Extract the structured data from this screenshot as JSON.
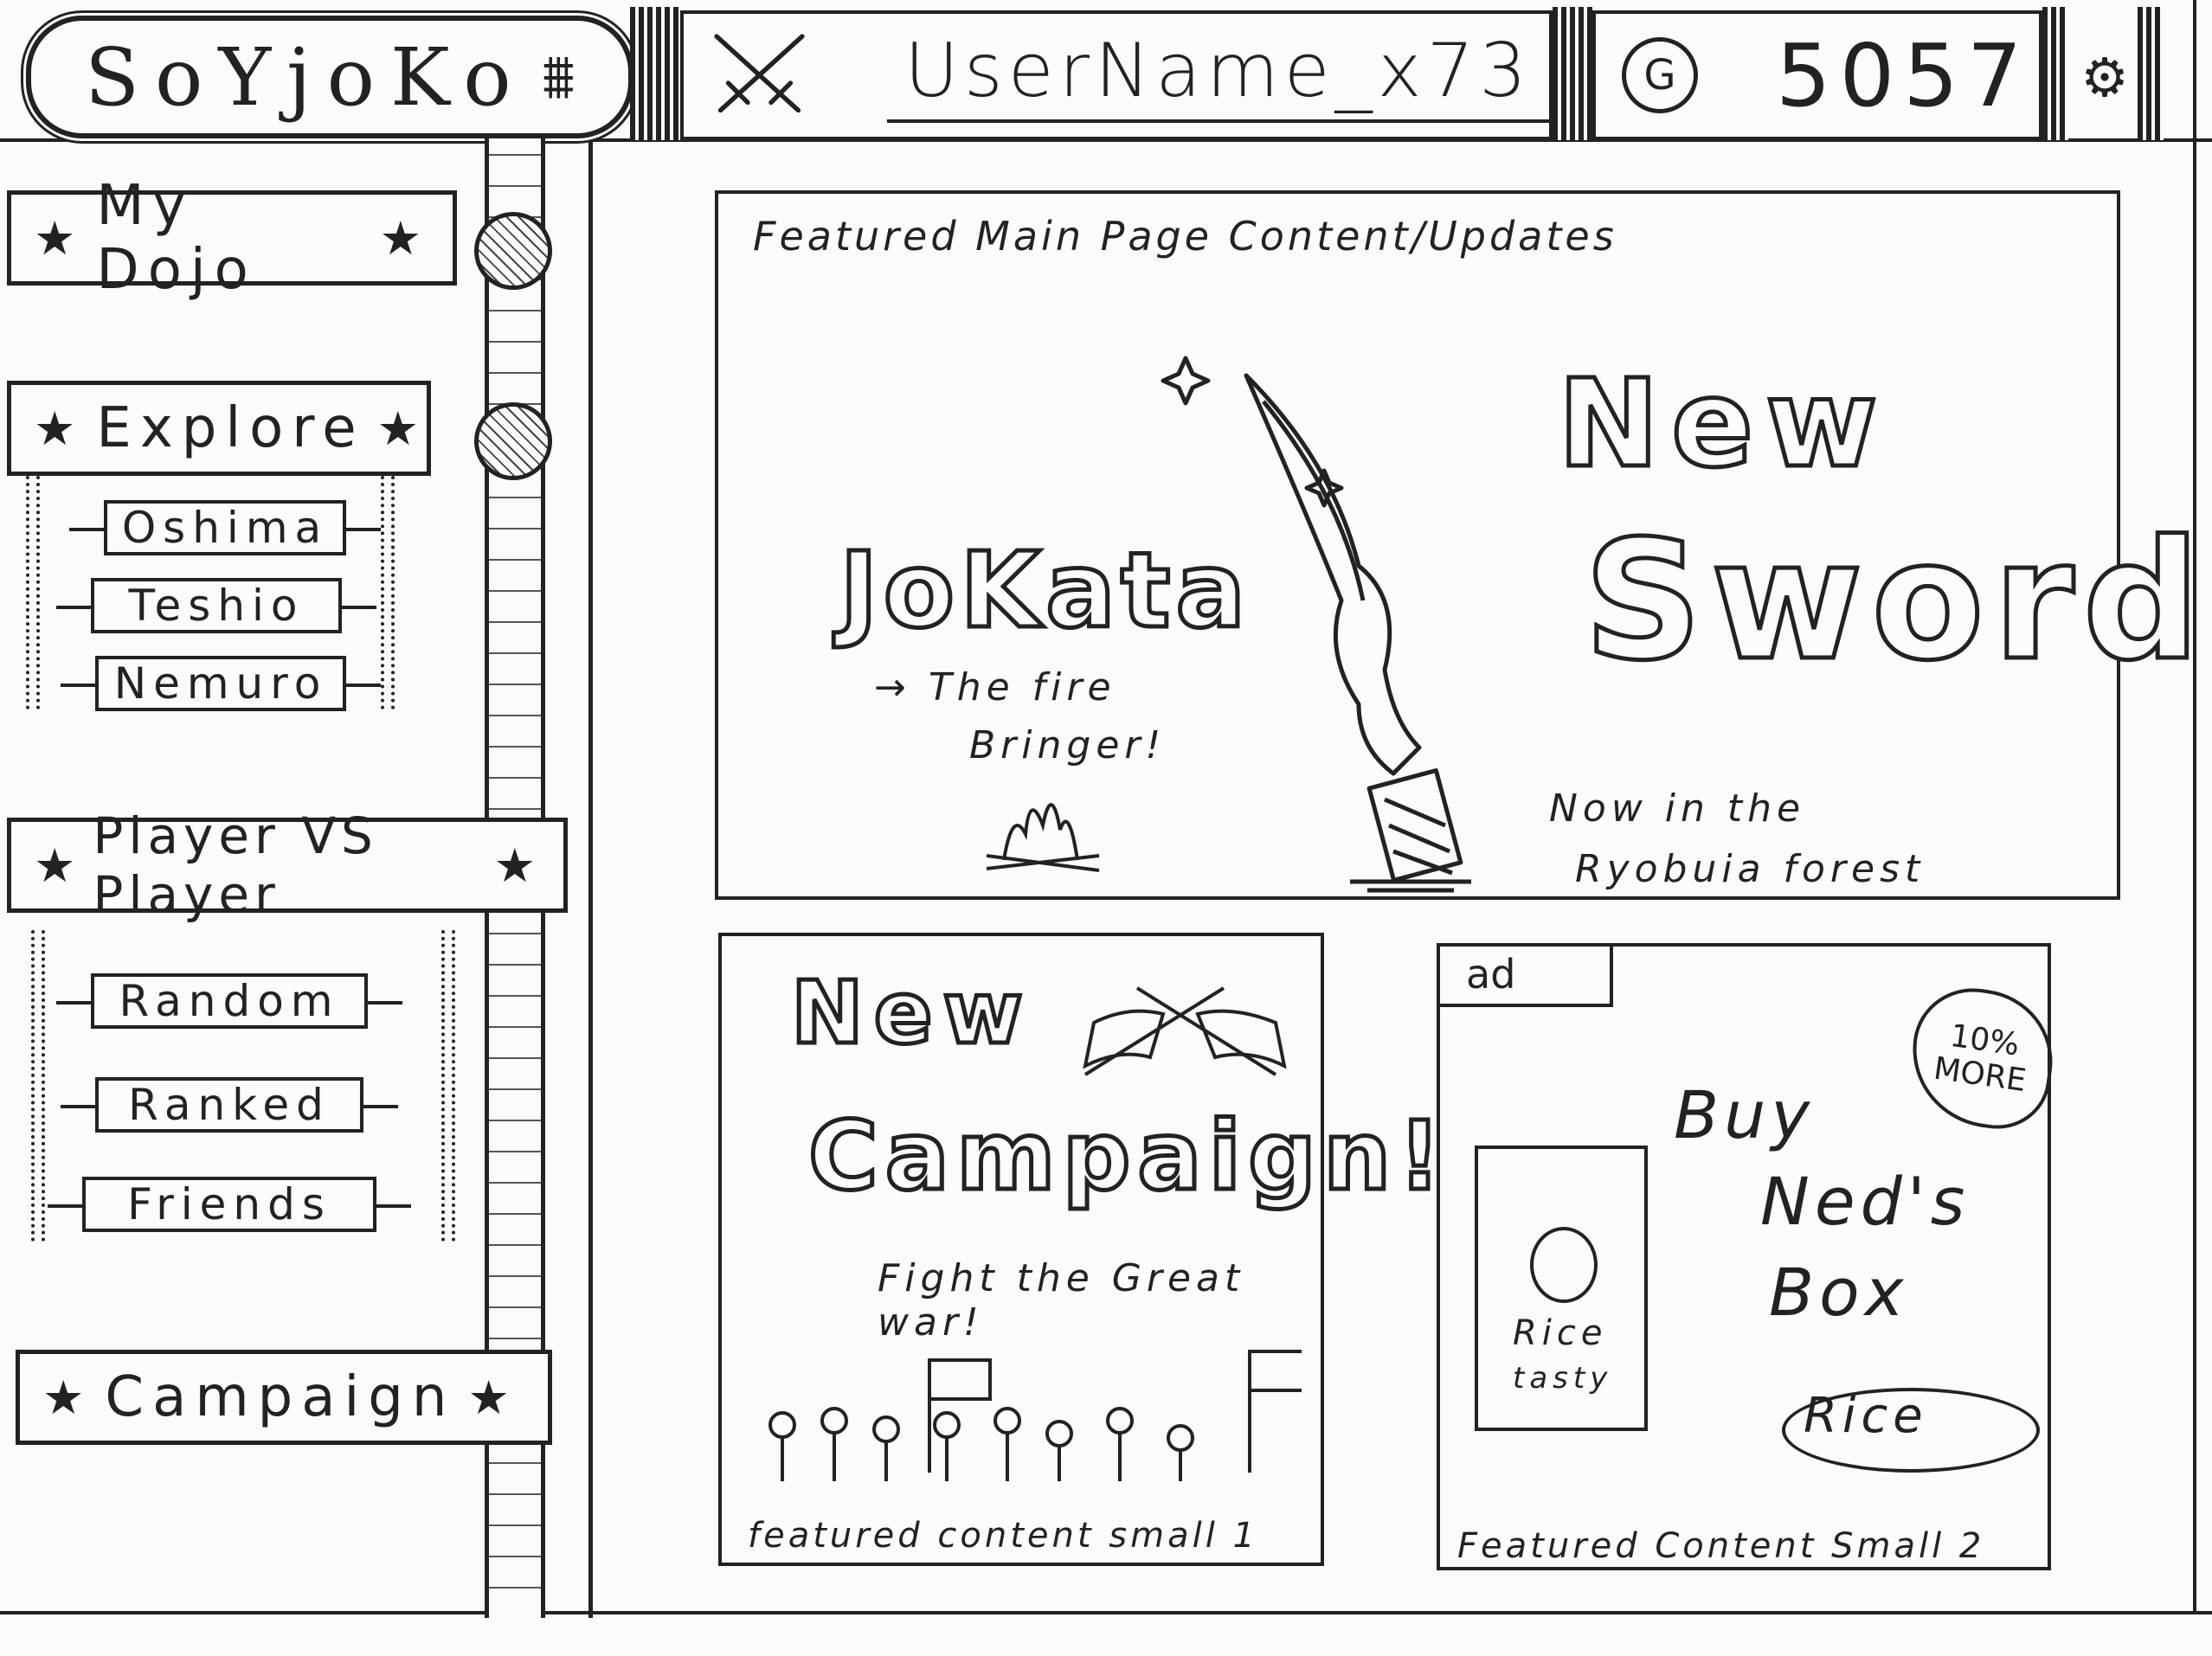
{
  "header": {
    "logo_text": "SoYjoKo",
    "logo_mark": "⩩",
    "username": "UserName_x73",
    "currency_icon_letter": "G",
    "gold": "5057",
    "icons": {
      "user": "crossed-swords-icon",
      "currency": "coin-icon",
      "settings": "gear-icon"
    }
  },
  "sidebar": {
    "my_dojo": "My Dojo",
    "explore": "Explore",
    "explore_items": [
      "Oshima",
      "Teshio",
      "Nemuro"
    ],
    "pvp": "Player VS Player",
    "pvp_items": [
      "Random",
      "Ranked",
      "Friends"
    ],
    "campaign": "Campaign"
  },
  "featured_main": {
    "caption": "Featured Main Page Content/Updates",
    "title": "JoKata",
    "subtitle_1": "→ The fire",
    "subtitle_2": "Bringer!",
    "headline_1": "New",
    "headline_2": "Sword",
    "note_1": "Now in the",
    "note_2": "Ryobuia forest"
  },
  "featured_small_1": {
    "headline_1": "New",
    "headline_2": "Campaign!",
    "tagline": "Fight the Great war!",
    "caption": "featured content small 1"
  },
  "featured_small_2": {
    "ad_label": "ad",
    "badge": "10% MORE",
    "line_1": "Buy",
    "line_2": "Ned's",
    "line_3": "Box",
    "bowl_label": "Rice",
    "box_label_1": "Rice",
    "box_label_2": "tasty",
    "caption": "Featured Content Small 2"
  }
}
